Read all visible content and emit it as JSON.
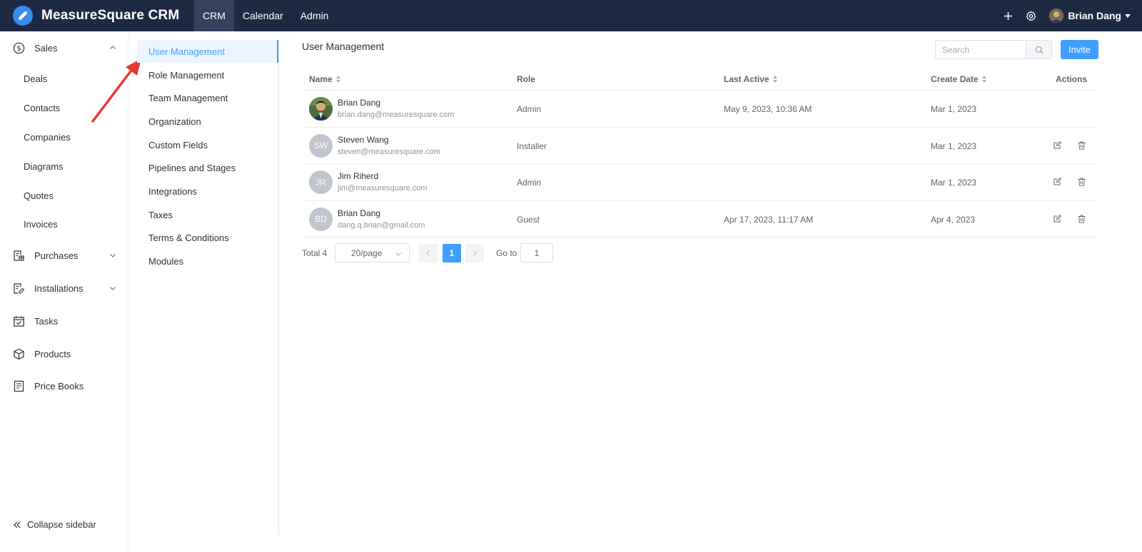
{
  "app": {
    "title": "MeasureSquare CRM"
  },
  "topnav": [
    {
      "label": "CRM",
      "active": true
    },
    {
      "label": "Calendar",
      "active": false
    },
    {
      "label": "Admin",
      "active": false
    }
  ],
  "topbar_icons": [
    "plus-icon",
    "gear-icon"
  ],
  "user": {
    "name": "Brian Dang"
  },
  "sidebar": {
    "sales": {
      "label": "Sales",
      "icon": "dollar-circle-icon",
      "expanded": true
    },
    "sales_items": [
      "Deals",
      "Contacts",
      "Companies",
      "Diagrams",
      "Quotes",
      "Invoices"
    ],
    "purchases": {
      "label": "Purchases",
      "icon": "purchases-icon"
    },
    "installations": {
      "label": "Installations",
      "icon": "installations-icon"
    },
    "tasks": {
      "label": "Tasks",
      "icon": "calendar-check-icon"
    },
    "products": {
      "label": "Products",
      "icon": "box-icon"
    },
    "price_books": {
      "label": "Price Books",
      "icon": "list-document-icon"
    },
    "collapse_label": "Collapse sidebar"
  },
  "admin_menu": [
    "User Management",
    "Role Management",
    "Team Management",
    "Organization",
    "Custom Fields",
    "Pipelines and Stages",
    "Integrations",
    "Taxes",
    "Terms & Conditions",
    "Modules"
  ],
  "admin_menu_active": "User Management",
  "main": {
    "title": "User Management",
    "search_placeholder": "Search",
    "invite_label": "Invite"
  },
  "table": {
    "columns": [
      "Name",
      "Role",
      "Last Active",
      "Create Date",
      "Actions"
    ],
    "rows": [
      {
        "initials": "",
        "has_photo": true,
        "name": "Brian Dang",
        "email": "brian.dang@measuresquare.com",
        "role": "Admin",
        "last_active": "May 9, 2023, 10:36 AM",
        "create_date": "Mar 1, 2023",
        "actions": false
      },
      {
        "initials": "SW",
        "has_photo": false,
        "name": "Steven Wang",
        "email": "steven@measuresquare.com",
        "role": "Installer",
        "last_active": "",
        "create_date": "Mar 1, 2023",
        "actions": true
      },
      {
        "initials": "JR",
        "has_photo": false,
        "name": "Jim Riherd",
        "email": "jim@measuresquare.com",
        "role": "Admin",
        "last_active": "",
        "create_date": "Mar 1, 2023",
        "actions": true
      },
      {
        "initials": "BD",
        "has_photo": false,
        "name": "Brian Dang",
        "email": "dang.q.brian@gmail.com",
        "role": "Guest",
        "last_active": "Apr 17, 2023, 11:17 AM",
        "create_date": "Apr 4, 2023",
        "actions": true
      }
    ]
  },
  "pagination": {
    "total_label": "Total 4",
    "page_size": "20/page",
    "current_page": "1",
    "goto_label": "Go to",
    "goto_value": "1"
  },
  "colors": {
    "topbar": "#1e2a44",
    "accent": "#409eff",
    "annotation_arrow": "#e53935"
  }
}
